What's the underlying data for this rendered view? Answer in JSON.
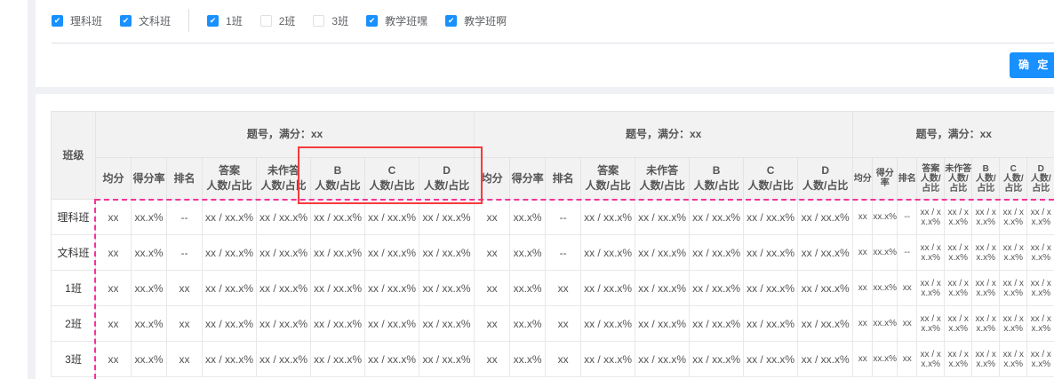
{
  "filters": {
    "group_a": [
      {
        "label": "理科班",
        "checked": true
      },
      {
        "label": "文科班",
        "checked": true
      }
    ],
    "group_b": [
      {
        "label": "1班",
        "checked": true
      },
      {
        "label": "2班",
        "checked": false
      },
      {
        "label": "3班",
        "checked": false
      },
      {
        "label": "教学班嘿",
        "checked": true
      },
      {
        "label": "教学班啊",
        "checked": true
      }
    ]
  },
  "confirm_label": "确 定",
  "table": {
    "class_header": "班级",
    "group_header": "题号，满分：xx",
    "groups": 3,
    "sub_headers": [
      [
        "均分"
      ],
      [
        "得分率"
      ],
      [
        "排名"
      ],
      [
        "答案",
        "人数/占比"
      ],
      [
        "未作答",
        "人数/占比"
      ],
      [
        "B",
        "人数/占比"
      ],
      [
        "C",
        "人数/占比"
      ],
      [
        "D",
        "人数/占比"
      ]
    ],
    "rows": [
      {
        "name": "理科班",
        "cells": [
          "xx",
          "xx.x%",
          "--",
          "xx / xx.x%",
          "xx / xx.x%",
          "xx / xx.x%",
          "xx / xx.x%",
          "xx / xx.x%"
        ]
      },
      {
        "name": "文科班",
        "cells": [
          "xx",
          "xx.x%",
          "--",
          "xx / xx.x%",
          "xx / xx.x%",
          "xx / xx.x%",
          "xx / xx.x%",
          "xx / xx.x%"
        ]
      },
      {
        "name": "1班",
        "cells": [
          "xx",
          "xx.x%",
          "xx",
          "xx / xx.x%",
          "xx / xx.x%",
          "xx / xx.x%",
          "xx / xx.x%",
          "xx / xx.x%"
        ]
      },
      {
        "name": "2班",
        "cells": [
          "xx",
          "xx.x%",
          "xx",
          "xx / xx.x%",
          "xx / xx.x%",
          "xx / xx.x%",
          "xx / xx.x%",
          "xx / xx.x%"
        ]
      },
      {
        "name": "3班",
        "cells": [
          "xx",
          "xx.x%",
          "xx",
          "xx / xx.x%",
          "xx / xx.x%",
          "xx / xx.x%",
          "xx / xx.x%",
          "xx / xx.x%"
        ]
      }
    ]
  }
}
